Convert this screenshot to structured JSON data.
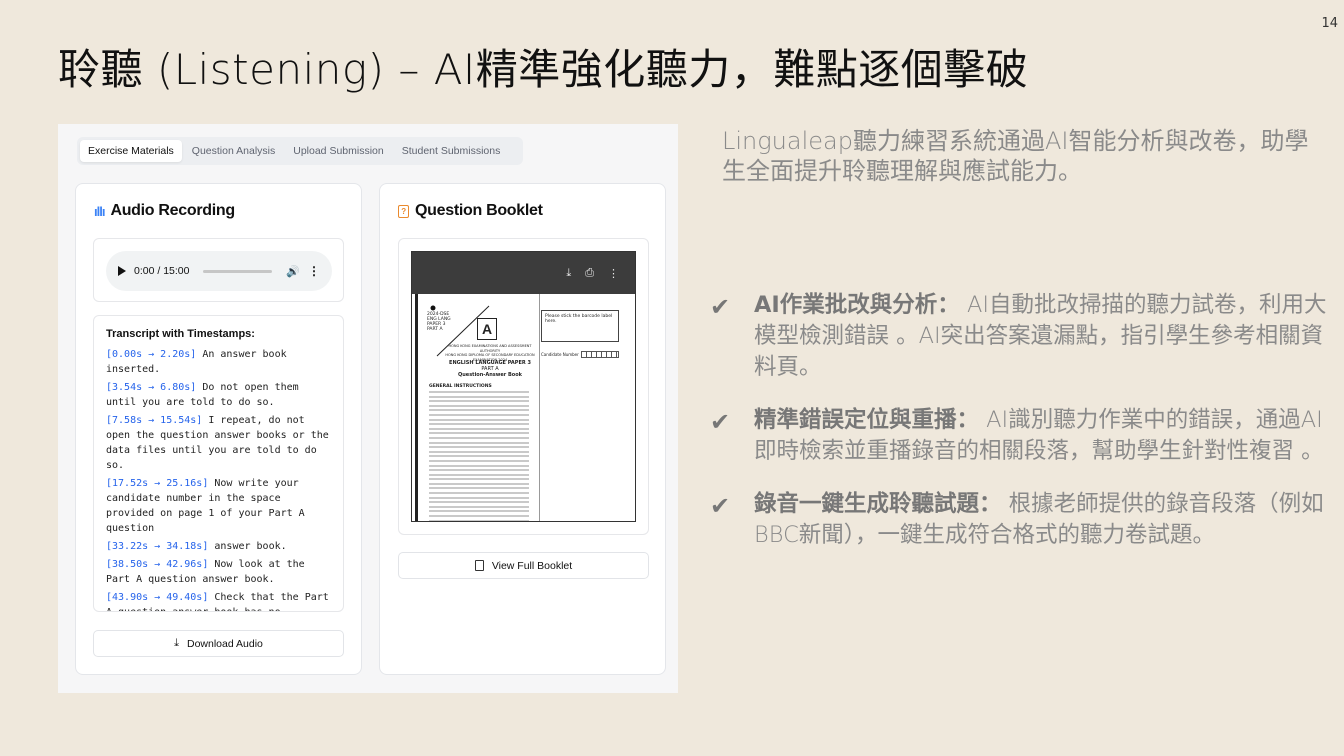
{
  "slide": {
    "number": "14",
    "title": "聆聽 (Listening) – AI精準強化聽力，難點逐個擊破"
  },
  "app": {
    "tabs": [
      {
        "label": "Exercise Materials",
        "active": true
      },
      {
        "label": "Question Analysis",
        "active": false
      },
      {
        "label": "Upload Submission",
        "active": false
      },
      {
        "label": "Student Submissions",
        "active": false
      }
    ],
    "audio_card": {
      "title": "Audio Recording",
      "icon": "audio-wave-icon",
      "player_time": "0:00 / 15:00",
      "transcript_heading": "Transcript with Timestamps:",
      "segments": [
        {
          "ts": "[0.00s → 2.20s]",
          "text": " An answer book inserted."
        },
        {
          "ts": "[3.54s → 6.80s]",
          "text": " Do not open them until you are told to do so."
        },
        {
          "ts": "[7.58s → 15.54s]",
          "text": " I repeat, do not open the question answer books or the data files until you are told to do so."
        },
        {
          "ts": "[17.52s → 25.16s]",
          "text": " Now write your candidate number in the space provided on page 1 of your Part A question"
        },
        {
          "ts": "[33.22s → 34.18s]",
          "text": " answer book."
        },
        {
          "ts": "[38.50s → 42.96s]",
          "text": " Now look at the Part A question answer book."
        },
        {
          "ts": "[43.90s → 49.40s]",
          "text": " Check that the Part A question answer book has no"
        }
      ],
      "download_label": "Download Audio"
    },
    "booklet_card": {
      "title": "Question Booklet",
      "icon": "document-icon",
      "pdf": {
        "header_lines": [
          "2024-DSE",
          "ENG LANG",
          "PAPER 3",
          "PART A"
        ],
        "part_letter": "A",
        "exam_lines": [
          "HONG KONG EXAMINATIONS AND ASSESSMENT AUTHORITY",
          "HONG KONG DIPLOMA OF SECONDARY EDUCATION EXAMINATION 2024"
        ],
        "paper_title": "ENGLISH LANGUAGE PAPER 3",
        "part_title": "PART A",
        "book_title": "Question-Answer Book",
        "instructions_heading": "GENERAL INSTRUCTIONS",
        "barcode_label": "Please stick the barcode label here.",
        "candidate_label": "Candidate Number"
      },
      "view_label": "View Full Booklet"
    }
  },
  "intro": "Lingualeap聽力練習系統通過AI智能分析與改卷，助學生全面提升聆聽理解與應試能力。",
  "bullets": [
    {
      "title": "AI作業批改與分析：",
      "text": " AI自動批改掃描的聽力試卷，利用大模型檢測錯誤 。AI突出答案遺漏點，指引學生參考相關資料頁。"
    },
    {
      "title": "精準錯誤定位與重播：",
      "text": " AI識別聽力作業中的錯誤，通過AI即時檢索並重播錄音的相關段落，幫助學生針對性複習 。"
    },
    {
      "title": "錄音一鍵生成聆聽試題：",
      "text": " 根據老師提供的錄音段落（例如BBC新聞），一鍵生成符合格式的聽力卷試題。"
    }
  ]
}
